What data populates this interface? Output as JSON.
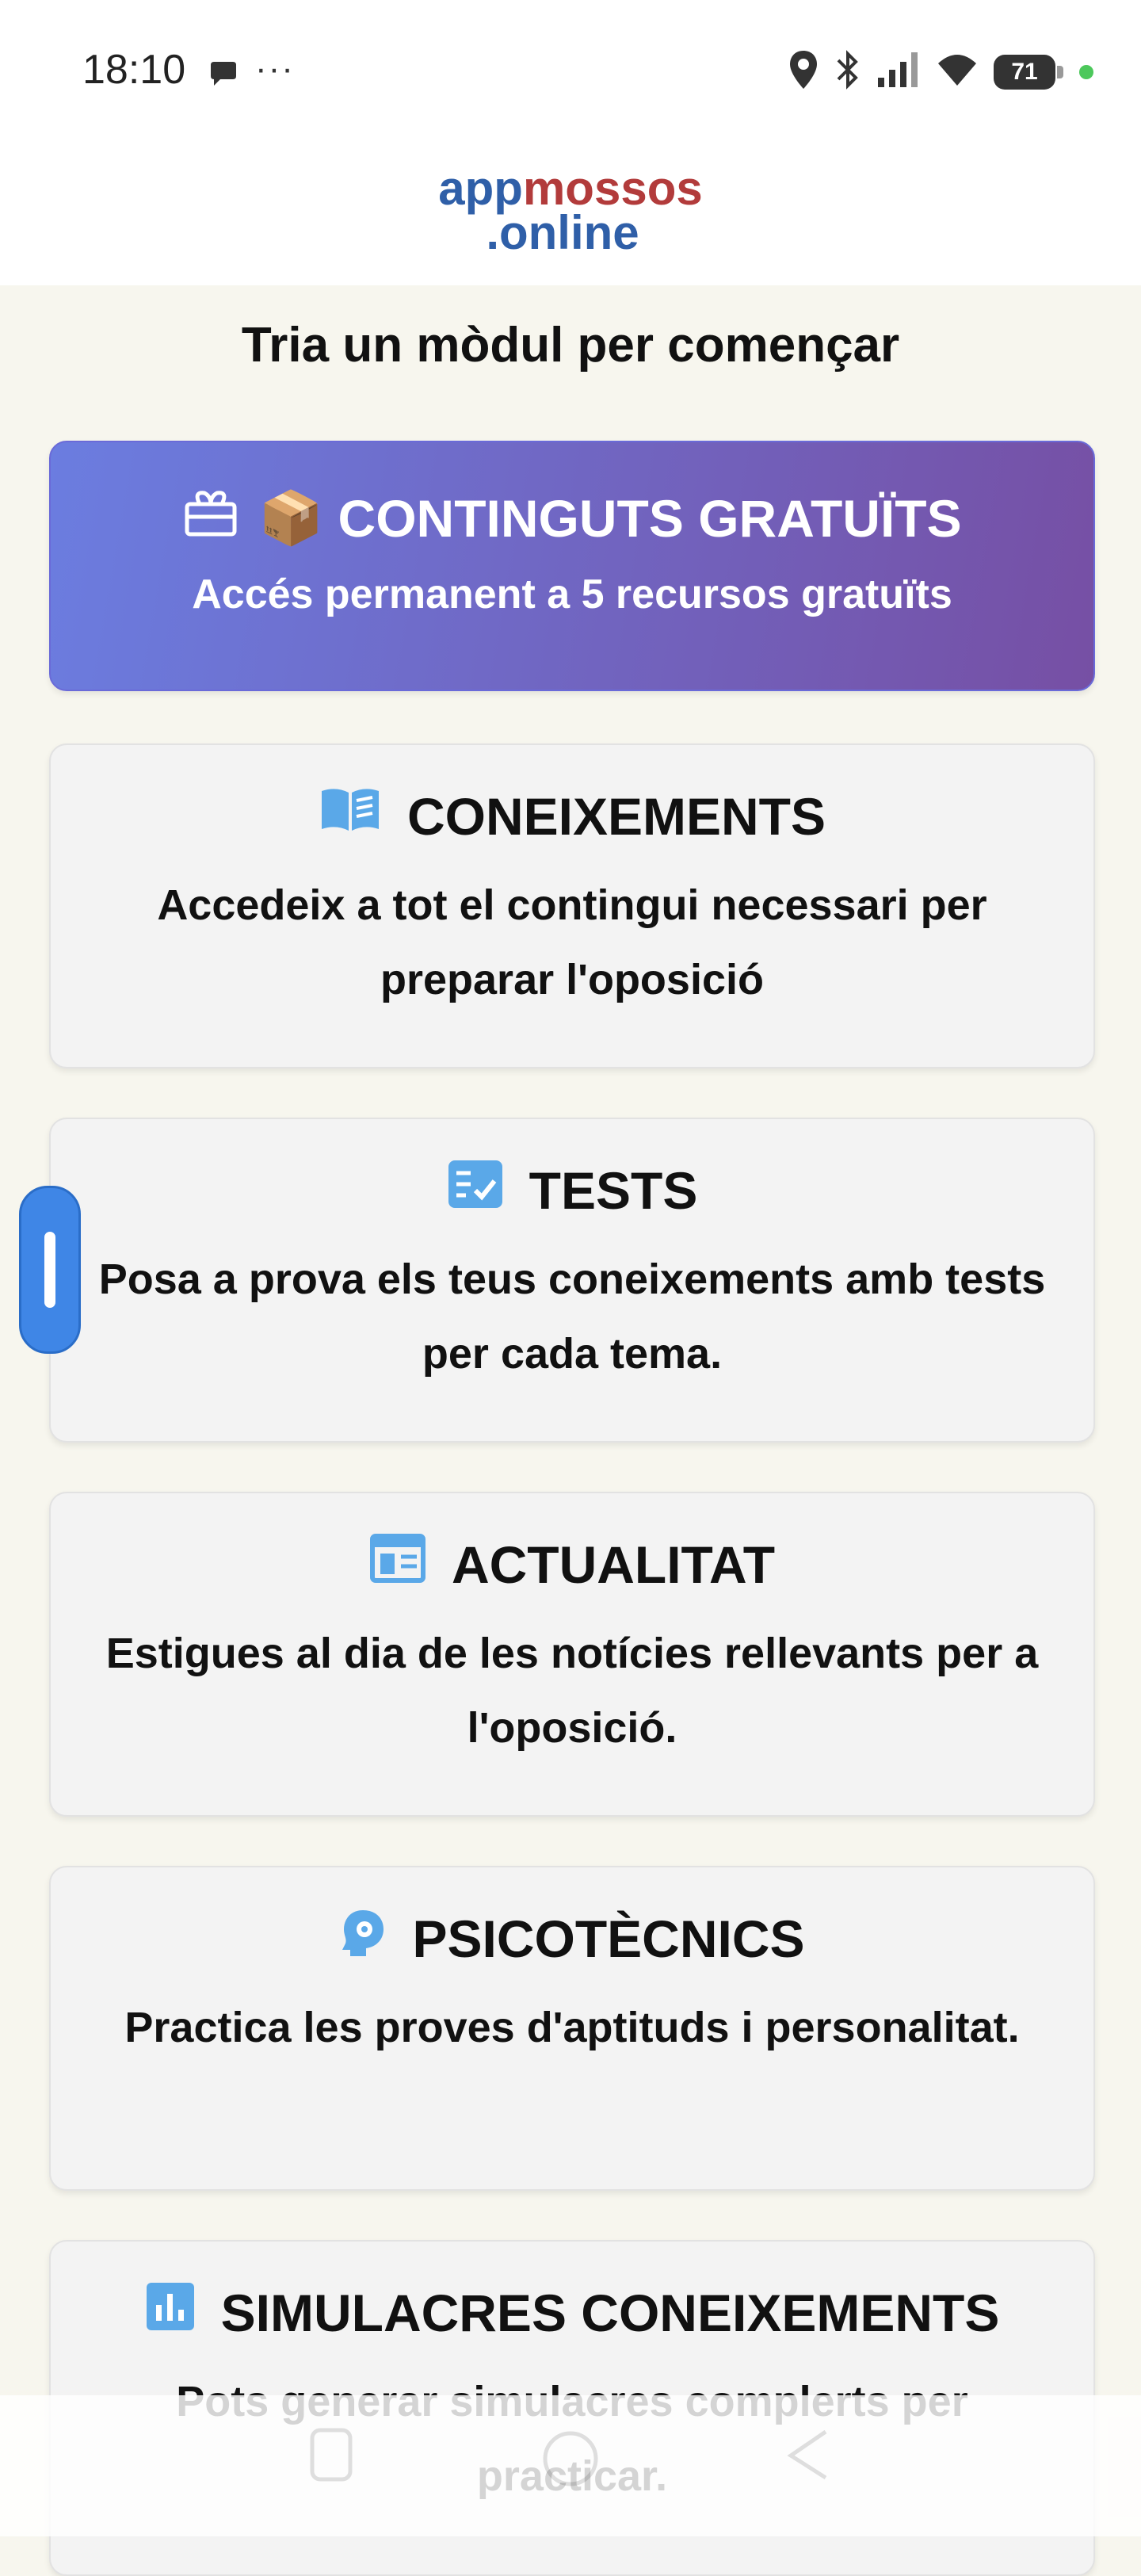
{
  "status_bar": {
    "time": "18:10",
    "more": "···",
    "battery": "71",
    "icons": [
      "chat-bubble-icon",
      "location-icon",
      "bluetooth-icon",
      "signal-icon",
      "wifi-icon",
      "battery-icon"
    ]
  },
  "header": {
    "logo_part1": "app",
    "logo_part2": "mossos",
    "logo_line2": ".online",
    "colors": {
      "blue": "#2f5fa8",
      "red": "#b23b3b"
    }
  },
  "page": {
    "title": "Tria un mòdul per començar"
  },
  "free_card": {
    "emoji": "📦",
    "title": "CONTINGUTS GRATUÏTS",
    "description": "Accés permanent a 5 recursos gratuïts",
    "icon": "gift-icon"
  },
  "modules": [
    {
      "title": "CONEIXEMENTS",
      "description": "Accedeix a tot el contingui necessari per preparar l'oposició",
      "icon": "book-icon"
    },
    {
      "title": "TESTS",
      "description": "Posa a prova els teus coneixements amb tests per cada tema.",
      "icon": "checklist-icon"
    },
    {
      "title": "ACTUALITAT",
      "description": "Estigues al dia de les notícies rellevants per a l'oposició.",
      "icon": "newspaper-icon"
    },
    {
      "title": "PSICOTÈCNICS",
      "description": "Practica les proves d'aptituds i personalitat.",
      "icon": "brain-gear-icon"
    },
    {
      "title": "SIMULACRES CONEIXEMENTS",
      "description": "Pots generar simulacres complerts per practicar.",
      "icon": "bar-chart-icon"
    }
  ],
  "colors": {
    "accent_icon": "#5aa8e8",
    "gradient_start": "#6b7de0",
    "gradient_end": "#764fa4"
  }
}
